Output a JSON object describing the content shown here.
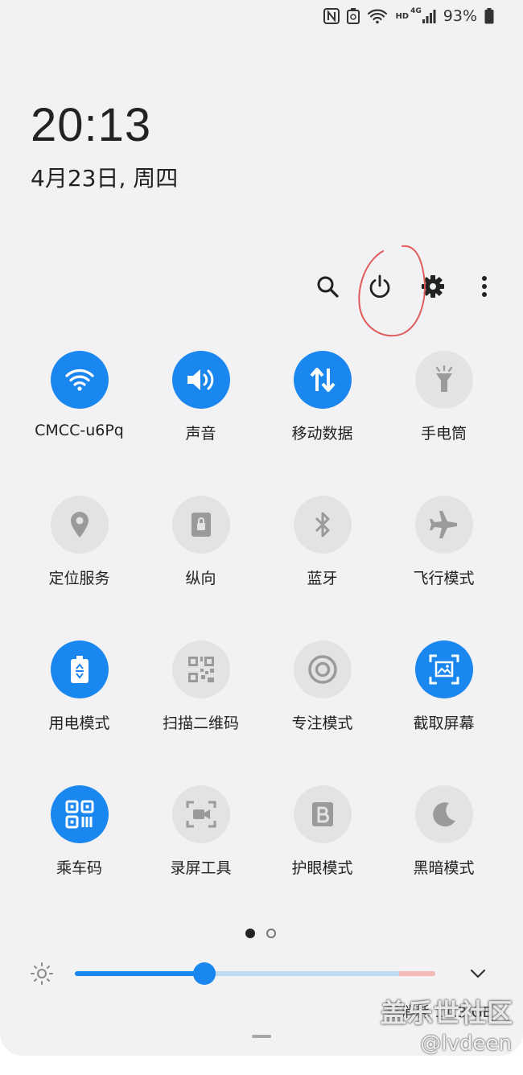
{
  "status_bar": {
    "network_label": "HD",
    "cell_label": "4G",
    "battery_percent": "93%",
    "icons": [
      "nfc-icon",
      "battery-saver-icon",
      "wifi-icon",
      "cell-signal-icon",
      "battery-icon"
    ]
  },
  "clock": {
    "time": "20:13",
    "date": "4月23日, 周四"
  },
  "top_icons": [
    "search-icon",
    "power-icon",
    "settings-icon",
    "more-icon"
  ],
  "tiles": [
    {
      "label": "CMCC-u6Pq",
      "icon": "wifi-icon",
      "on": true
    },
    {
      "label": "声音",
      "icon": "sound-icon",
      "on": true
    },
    {
      "label": "移动数据",
      "icon": "mobile-data-icon",
      "on": true
    },
    {
      "label": "手电筒",
      "icon": "flashlight-icon",
      "on": false
    },
    {
      "label": "定位服务",
      "icon": "location-icon",
      "on": false
    },
    {
      "label": "纵向",
      "icon": "portrait-lock-icon",
      "on": false
    },
    {
      "label": "蓝牙",
      "icon": "bluetooth-icon",
      "on": false
    },
    {
      "label": "飞行模式",
      "icon": "airplane-icon",
      "on": false
    },
    {
      "label": "用电模式",
      "icon": "power-mode-icon",
      "on": true
    },
    {
      "label": "扫描二维码",
      "icon": "qr-scan-icon",
      "on": false
    },
    {
      "label": "专注模式",
      "icon": "focus-icon",
      "on": false
    },
    {
      "label": "截取屏幕",
      "icon": "screenshot-icon",
      "on": true
    },
    {
      "label": "乘车码",
      "icon": "ride-code-icon",
      "on": true
    },
    {
      "label": "录屏工具",
      "icon": "screen-record-icon",
      "on": false
    },
    {
      "label": "护眼模式",
      "icon": "eye-comfort-icon",
      "on": false
    },
    {
      "label": "黑暗模式",
      "icon": "dark-mode-icon",
      "on": false
    }
  ],
  "pager": {
    "current": 1,
    "total": 2
  },
  "brightness": {
    "level": 0.36
  },
  "data_usage": "已消耗 11.3 GB",
  "watermark": {
    "site": "盖乐世社区",
    "user": "@lvdeen"
  },
  "colors": {
    "accent": "#1a86f0",
    "tile_off": "#e3e3e5",
    "annotation": "#e05a5a"
  }
}
